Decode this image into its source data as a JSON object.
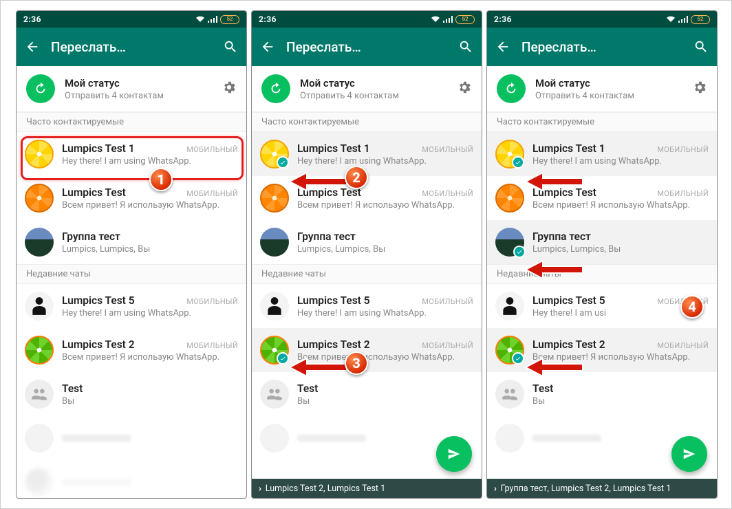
{
  "statusbar": {
    "time": "2:36",
    "battery": "52"
  },
  "header": {
    "title": "Переслать…"
  },
  "status": {
    "title": "Мой статус",
    "subtitle": "Отправить 4 контактам"
  },
  "sections": {
    "frequent": "Часто контактируемые",
    "recent": "Недавние чаты"
  },
  "tag_mobile": "МОБИЛЬНЫЙ",
  "contacts": {
    "lumpics_test_1": {
      "name": "Lumpics Test 1",
      "status": "Hey there! I am using WhatsApp."
    },
    "lumpics_test": {
      "name": "Lumpics Test",
      "status": "Всем привет! Я использую WhatsApp."
    },
    "group_test": {
      "name": "Группа тест",
      "status": "Lumpics, Lumpics, Вы"
    },
    "lumpics_test_5": {
      "name": "Lumpics Test 5",
      "status": "Hey there! I am using WhatsApp."
    },
    "lumpics_test_2": {
      "name": "Lumpics Test 2",
      "status": "Всем привет! Я использую WhatsApp."
    },
    "test": {
      "name": "Test",
      "status": "Вы"
    }
  },
  "contacts_p3": {
    "lumpics_test_5_status": "Hey there! I am usi"
  },
  "footer": {
    "p2": "Lumpics Test 2, Lumpics Test 1",
    "p3": "Группа тест, Lumpics Test 2, Lumpics Test 1"
  },
  "badges": {
    "b1": "1",
    "b2": "2",
    "b3": "3",
    "b4": "4"
  }
}
